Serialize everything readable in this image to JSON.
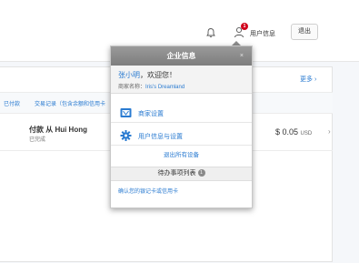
{
  "header": {
    "notification_badge": "1",
    "user_info_label": "用户信息",
    "logout_label": "退出"
  },
  "main": {
    "more_link": "更多 ›",
    "filters": [
      "已付款",
      "交易记录（包含余额和信用卡"
    ],
    "transaction": {
      "title": "付款 从 Hui Hong",
      "status": "已完成",
      "amount": "$ 0.05",
      "currency": "USD",
      "chevron": "›"
    }
  },
  "popup": {
    "title": "企业信息",
    "close_glyph": "×",
    "greeting_name": "张小明",
    "greeting_suffix": "，欢迎您！",
    "merchant_label": "商家名称：",
    "merchant_name": "Iris's Dreamland",
    "menu": [
      {
        "label": "商家设置",
        "icon": "store-settings-icon"
      },
      {
        "label": "用户信息与设置",
        "icon": "gear-icon"
      }
    ],
    "logout_all": "退出所有设备",
    "todo_title": "待办事项列表",
    "todo_count": "1",
    "todo_item": "确认您的银记卡或信用卡"
  },
  "colors": {
    "link": "#2a7bd1",
    "badge": "#d0021b",
    "popup_header": "#8a8a8a"
  }
}
